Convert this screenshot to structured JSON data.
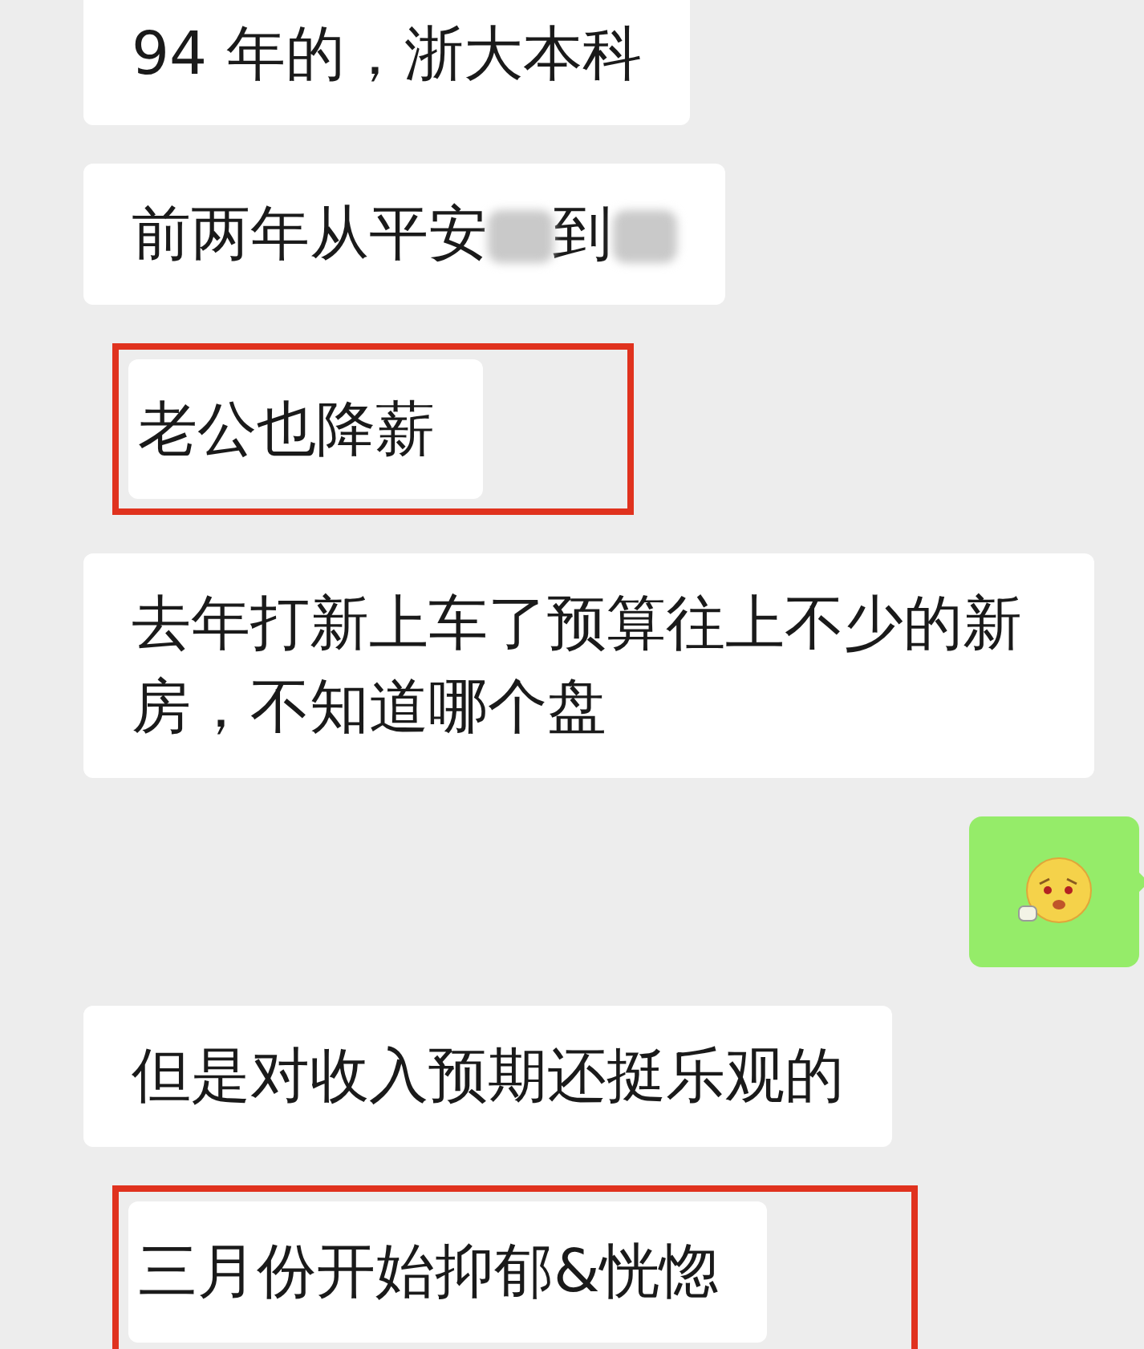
{
  "messages": [
    {
      "kind": "text",
      "outgoing": false,
      "highlighted": false,
      "text": "94 年的，浙大本科"
    },
    {
      "kind": "segments",
      "outgoing": false,
      "highlighted": false,
      "segments": [
        {
          "kind": "text",
          "text": "前两年从平安"
        },
        {
          "kind": "redacted"
        },
        {
          "kind": "text",
          "text": "到"
        },
        {
          "kind": "redacted"
        }
      ]
    },
    {
      "kind": "text",
      "outgoing": false,
      "highlighted": true,
      "text": "老公也降薪"
    },
    {
      "kind": "text",
      "outgoing": false,
      "highlighted": false,
      "text": "去年打新上车了预算往上不少的新房，不知道哪个盘"
    },
    {
      "kind": "sticker",
      "outgoing": true,
      "highlighted": false
    },
    {
      "kind": "text",
      "outgoing": false,
      "highlighted": false,
      "text": "但是对收入预期还挺乐观的"
    },
    {
      "kind": "text",
      "outgoing": false,
      "highlighted": true,
      "text": "三月份开始抑郁&恍惚"
    }
  ]
}
